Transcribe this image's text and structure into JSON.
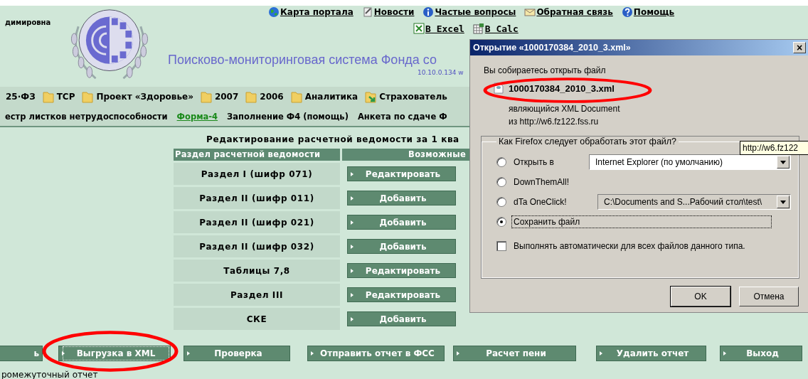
{
  "user_name": "димировна",
  "top_links": [
    "Карта портала",
    "Новости",
    "Частые вопросы",
    "Обратная связь",
    "Помощь"
  ],
  "export_links": [
    "В Excel",
    "В Calc"
  ],
  "title": "Поисково-мониторинговая система Фонда со",
  "server": "10.10.0.134 w",
  "menu": [
    {
      "label": "25·ФЗ",
      "kind": "plain"
    },
    {
      "label": "ТСР",
      "kind": "folder"
    },
    {
      "label": "Проект «Здоровье»",
      "kind": "folder"
    },
    {
      "label": "2007",
      "kind": "folder"
    },
    {
      "label": "2006",
      "kind": "folder"
    },
    {
      "label": "Аналитика",
      "kind": "folder"
    },
    {
      "label": "Страхователь",
      "kind": "folder-arrow"
    }
  ],
  "submenu": [
    {
      "label": "естр листков нетрудоспособности",
      "selected": false
    },
    {
      "label": "Форма-4",
      "selected": true
    },
    {
      "label": "Заполнение Ф4 (помощь)",
      "selected": false
    },
    {
      "label": "Анкета по сдаче Ф",
      "selected": false
    }
  ],
  "heading": "Редактирование расчетной ведомости за 1 ква",
  "table": {
    "columns": [
      "Раздел расчетной ведомости",
      "Возможные"
    ],
    "rows": [
      {
        "section": "Раздел I (шифр 071)",
        "action": "Редактировать"
      },
      {
        "section": "Раздел II (шифр 011)",
        "action": "Добавить"
      },
      {
        "section": "Раздел II (шифр 021)",
        "action": "Добавить"
      },
      {
        "section": "Раздел II (шифр 032)",
        "action": "Добавить"
      },
      {
        "section": "Таблицы 7,8",
        "action": "Редактировать"
      },
      {
        "section": "Раздел III",
        "action": "Редактировать"
      },
      {
        "section": "СКЕ",
        "action": "Добавить"
      }
    ]
  },
  "actions": [
    {
      "label": "ь",
      "focused": false
    },
    {
      "label": "Выгрузка в XML",
      "focused": true
    },
    {
      "label": "Проверка",
      "focused": false
    },
    {
      "label": "Отправить отчет в ФСС",
      "focused": false
    },
    {
      "label": "Расчет пени",
      "focused": false
    },
    {
      "label": "Удалить отчет",
      "focused": false
    },
    {
      "label": "Выход",
      "focused": false
    }
  ],
  "footer_note": "ромежуточный отчет",
  "dialog": {
    "title": "Открытие «1000170384_2010_3.xml»",
    "close": "×",
    "intro": "Вы собираетесь открыть файл",
    "file_name": "1000170384_2010_3.xml",
    "file_type": "являющийся  XML Document",
    "source": "из  http://w6.fz122.fss.ru",
    "group_label": "Как Firefox следует обработать этот файл?",
    "options": [
      {
        "label": "Открыть в",
        "selected": false,
        "select_value": "Internet Explorer (по умолчанию)"
      },
      {
        "label": "DownThemAll!",
        "selected": false
      },
      {
        "label": "dTa OneClick!",
        "selected": false,
        "select_value": "C:\\Documents and S...Рабочий стол\\test\\"
      },
      {
        "label": "Сохранить файл",
        "selected": true
      }
    ],
    "auto_checkbox": {
      "label": "Выполнять автоматически для всех файлов данного типа.",
      "checked": false
    },
    "buttons": [
      "OK",
      "Отмена"
    ]
  },
  "tooltip": "http://w6.fz122"
}
